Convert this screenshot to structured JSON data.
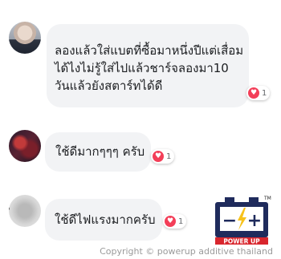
{
  "comments": [
    {
      "text": "ลองแล้วใส่แบตที่ซื้อมาหนึ่งปีแต่เสื่อม\nได้ไงไม่รู้ใส่ไปแล้วชาร์จลองมา10\nวันแล้วยังสตาร์ทได้ดี",
      "reaction_count": "1",
      "reaction_icon": "heart-icon"
    },
    {
      "text": "ใช้ดีมากๆๆๆ ครับ",
      "reaction_count": "1",
      "reaction_icon": "heart-icon"
    },
    {
      "text": "ใช้ดีไฟแรงมากครับ",
      "reaction_count": "1",
      "reaction_icon": "heart-icon"
    }
  ],
  "logo": {
    "minus": "−",
    "plus": "+",
    "brand": "POWER UP",
    "tm": "TM"
  },
  "copyright": {
    "text": "Copyright © powerup additive thailand"
  },
  "colors": {
    "bubble": "#f2f3f5",
    "heart": "#f33e58",
    "logo_blue": "#1f2b5c",
    "logo_yellow": "#f7c21b",
    "logo_red": "#d8262d"
  }
}
